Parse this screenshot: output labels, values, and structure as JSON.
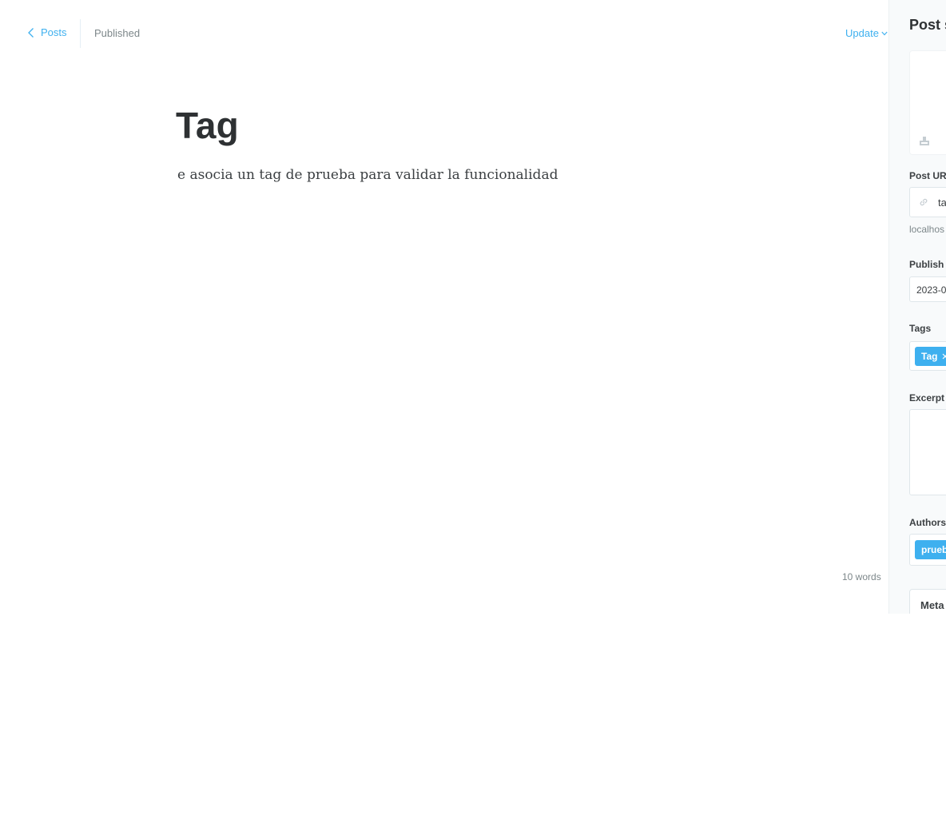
{
  "header": {
    "back_label": "Posts",
    "status": "Published",
    "update_label": "Update"
  },
  "editor": {
    "title": "Tag",
    "body": "e asocia un tag de prueba para validar la funcionalidad",
    "word_count": "10 words"
  },
  "settings": {
    "title": "Post s",
    "url_label": "Post UR",
    "url_value": "ta",
    "url_hint": "localhos",
    "publish_label": "Publish",
    "publish_date": "2023-0",
    "tags_label": "Tags",
    "tags": [
      {
        "label": "Tag"
      }
    ],
    "excerpt_label": "Excerpt",
    "authors_label": "Authors",
    "authors": [
      {
        "label": "prueb"
      }
    ],
    "meta_label": "Meta"
  },
  "colors": {
    "accent": "#3eb0ef",
    "panel_bg": "#f8fafb",
    "muted_text": "#7d878a"
  }
}
